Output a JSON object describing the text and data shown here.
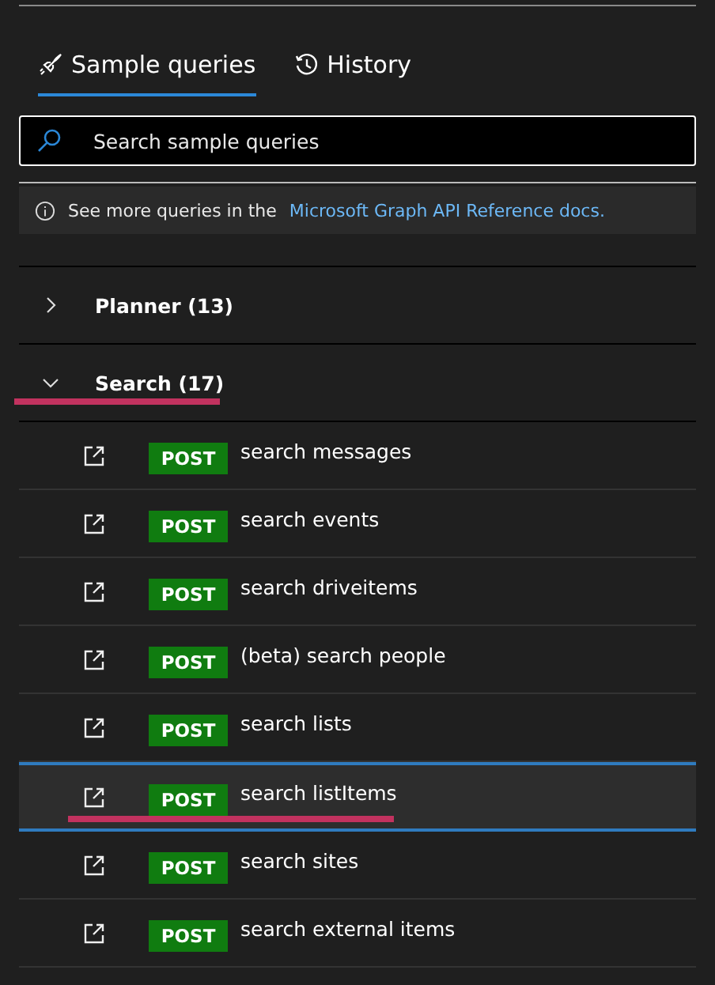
{
  "tabs": [
    {
      "label": "Sample queries",
      "kind": "rocket",
      "selected": true
    },
    {
      "label": "History",
      "kind": "history",
      "selected": false
    }
  ],
  "search": {
    "placeholder": "Search sample queries"
  },
  "banner": {
    "text": "See more queries in the",
    "link": "Microsoft Graph API Reference docs."
  },
  "groups": [
    {
      "label": "Planner (13)",
      "expanded": false,
      "underlined": false
    },
    {
      "label": "Search (17)",
      "expanded": true,
      "underlined": true,
      "items": [
        {
          "method": "POST",
          "label": "search messages",
          "selected": false,
          "underlined": false
        },
        {
          "method": "POST",
          "label": "search events",
          "selected": false,
          "underlined": false
        },
        {
          "method": "POST",
          "label": "search driveitems",
          "selected": false,
          "underlined": false
        },
        {
          "method": "POST",
          "label": "(beta) search people",
          "selected": false,
          "underlined": false
        },
        {
          "method": "POST",
          "label": "search lists",
          "selected": false,
          "underlined": false
        },
        {
          "method": "POST",
          "label": "search listItems",
          "selected": true,
          "underlined": true
        },
        {
          "method": "POST",
          "label": "search sites",
          "selected": false,
          "underlined": false
        },
        {
          "method": "POST",
          "label": "search external items",
          "selected": false,
          "underlined": false
        }
      ]
    }
  ]
}
